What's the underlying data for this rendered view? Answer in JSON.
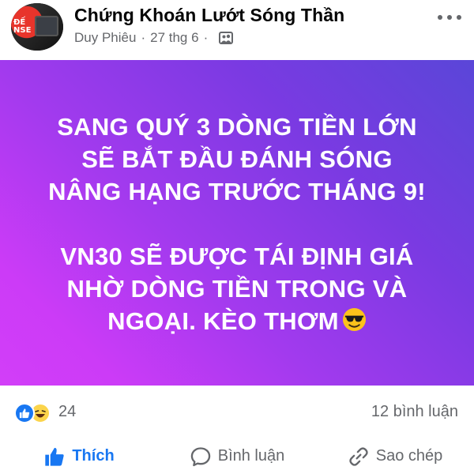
{
  "post": {
    "page_name": "Chứng Khoán Lướt Sóng Thần",
    "author": "Duy Phiêu",
    "separator": "·",
    "date": "27 thg 6",
    "avatar_text": "ĐẾ\nNSE",
    "text_lines": [
      "SANG QUÝ 3 DÒNG TIỀN LỚN",
      "SẼ BẮT ĐẦU ĐÁNH SÓNG",
      "NÂNG HẠNG TRƯỚC THÁNG 9!",
      "",
      "VN30 SẼ ĐƯỢC TÁI ĐỊNH GIÁ",
      "NHỜ DÒNG TIỀN TRONG VÀ",
      "NGOẠI. KÈO THƠM"
    ],
    "background_colors": [
      "#5a46d8",
      "#a23aee",
      "#d23ef8"
    ],
    "emoji": "smiling-face-with-sunglasses"
  },
  "reactions": {
    "types": [
      "like",
      "haha"
    ],
    "count": "24",
    "comments": "12 bình luận"
  },
  "actions": {
    "like": "Thích",
    "comment": "Bình luận",
    "copy": "Sao chép"
  },
  "colors": {
    "accent": "#1877f2",
    "secondary_text": "#65676b"
  },
  "icons": {
    "audience": "page-audience-icon",
    "more": "more-dots-icon",
    "like": "thumbs-up-icon",
    "comment": "speech-bubble-icon",
    "copy": "link-icon"
  }
}
